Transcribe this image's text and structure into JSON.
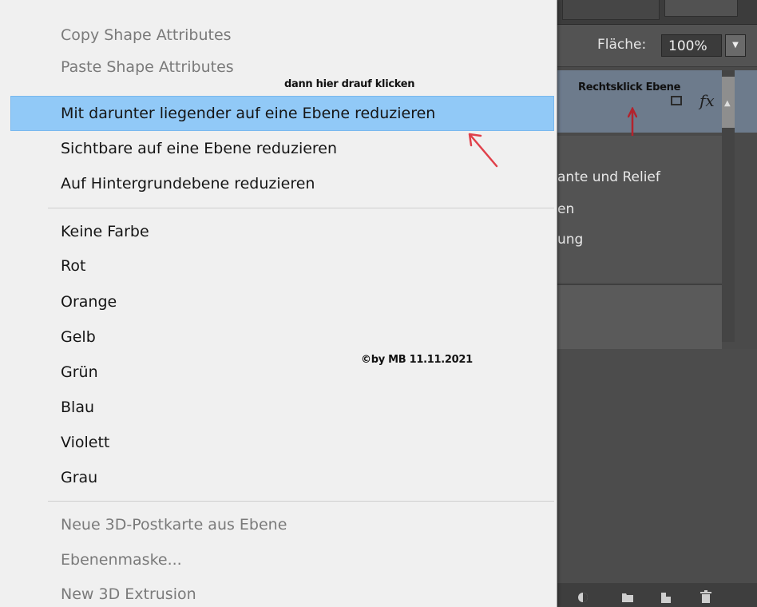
{
  "context_menu": {
    "items_top": [
      {
        "label": "Copy Shape Attributes",
        "disabled": true
      },
      {
        "label": "Paste Shape Attributes",
        "disabled": true
      },
      {
        "label": "Mit darunter liegender auf eine Ebene reduzieren",
        "disabled": false,
        "highlighted": true
      },
      {
        "label": "Sichtbare auf eine Ebene reduzieren",
        "disabled": false
      },
      {
        "label": "Auf Hintergrundebene reduzieren",
        "disabled": false
      }
    ],
    "colors": [
      "Keine Farbe",
      "Rot",
      "Orange",
      "Gelb",
      "Grün",
      "Blau",
      "Violett",
      "Grau"
    ],
    "items_bottom": [
      {
        "label": "Neue 3D-Postkarte aus Ebene",
        "disabled": true
      },
      {
        "label": "Ebenenmaske...",
        "disabled": true
      },
      {
        "label": "New 3D Extrusion",
        "disabled": true
      }
    ],
    "highlight_color": "#91c9f7"
  },
  "annotations": {
    "click_here": "dann hier drauf klicken",
    "right_click_layer": "Rechtsklick Ebene",
    "copyright": "©by MB 11.11.2021",
    "arrow_color": "#e0404a"
  },
  "layers_panel": {
    "fill_label": "Fläche:",
    "fill_value": "100%",
    "fx_label": "fx",
    "effects": [
      "ante und Relief",
      "en",
      "ung"
    ],
    "bottom_icons": [
      "adjustment-layer-icon",
      "folder-icon",
      "new-layer-icon",
      "trash-icon"
    ]
  }
}
